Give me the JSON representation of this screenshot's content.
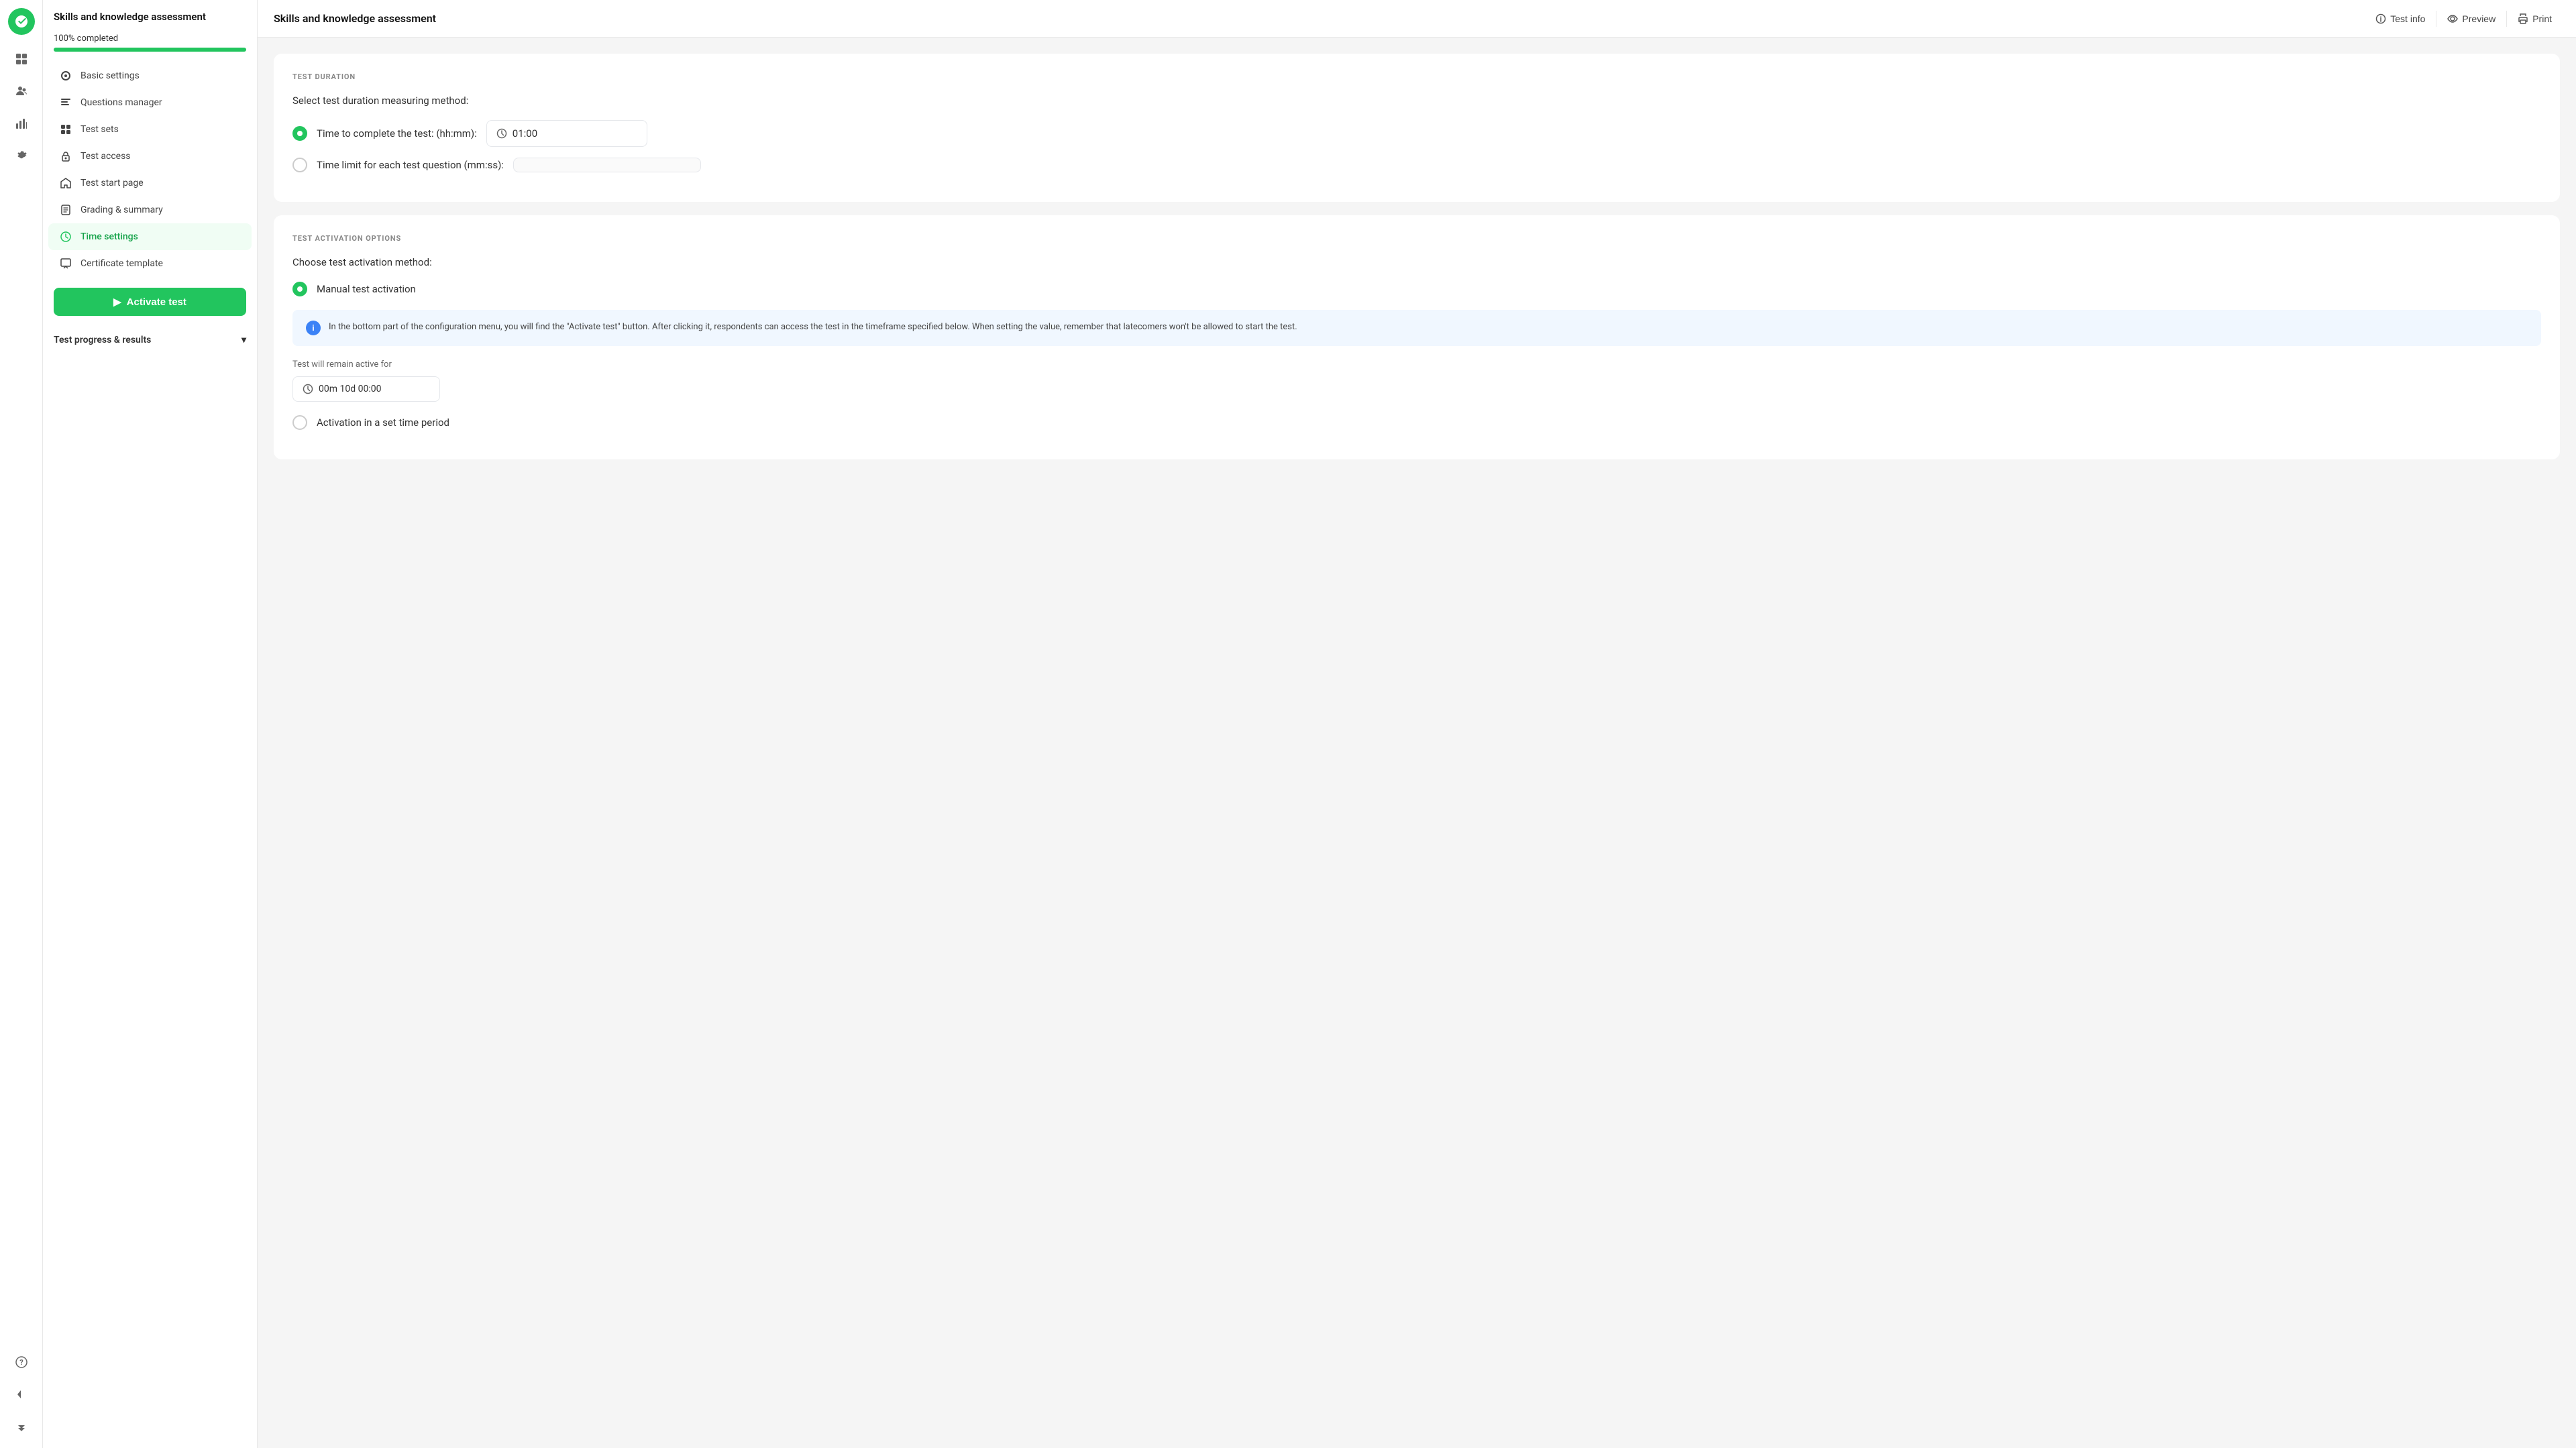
{
  "app": {
    "logo_alt": "logo",
    "title": "Skills and knowledge assessment"
  },
  "header": {
    "title": "Skills and knowledge assessment",
    "actions": [
      {
        "id": "test-info",
        "label": "Test info",
        "icon": "info-circle"
      },
      {
        "id": "preview",
        "label": "Preview",
        "icon": "eye"
      },
      {
        "id": "print",
        "label": "Print",
        "icon": "printer"
      }
    ]
  },
  "sidebar": {
    "progress_label": "100% completed",
    "progress_value": 100,
    "nav_items": [
      {
        "id": "basic-settings",
        "label": "Basic settings",
        "icon": "settings",
        "active": false
      },
      {
        "id": "questions-manager",
        "label": "Questions manager",
        "icon": "questions",
        "active": false
      },
      {
        "id": "test-sets",
        "label": "Test sets",
        "icon": "grid",
        "active": false
      },
      {
        "id": "test-access",
        "label": "Test access",
        "icon": "lock",
        "active": false
      },
      {
        "id": "test-start-page",
        "label": "Test start page",
        "icon": "home",
        "active": false
      },
      {
        "id": "grading-summary",
        "label": "Grading & summary",
        "icon": "list",
        "active": false
      },
      {
        "id": "time-settings",
        "label": "Time settings",
        "icon": "clock",
        "active": true
      },
      {
        "id": "certificate-template",
        "label": "Certificate template",
        "icon": "certificate",
        "active": false
      }
    ],
    "activate_button": "Activate test",
    "results_section": "Test progress & results"
  },
  "content": {
    "test_duration": {
      "section_label": "TEST DURATION",
      "subtitle": "Select test duration measuring method:",
      "options": [
        {
          "id": "time-to-complete",
          "label": "Time to complete the test: (hh:mm):",
          "selected": true,
          "value": "01:00"
        },
        {
          "id": "time-limit-per-question",
          "label": "Time limit for each test question (mm:ss):",
          "selected": false,
          "value": ""
        }
      ]
    },
    "test_activation": {
      "section_label": "TEST ACTIVATION OPTIONS",
      "subtitle": "Choose test activation method:",
      "options": [
        {
          "id": "manual-activation",
          "label": "Manual test activation",
          "selected": true
        }
      ],
      "info_text": "In the bottom part of the configuration menu, you will find the \"Activate test\" button. After clicking it, respondents can access the test in the timeframe specified below. When setting the value, remember that latecomers won't be allowed to start the test.",
      "active_for_label": "Test will remain active for",
      "active_for_value": "00m 10d 00:00",
      "set_time_option": {
        "id": "set-time-period",
        "label": "Activation in a set time period",
        "selected": false
      }
    }
  },
  "icons": {
    "play": "▶",
    "chevron_down": "▾",
    "clock": "🕐",
    "info": "i",
    "check": "✓"
  }
}
